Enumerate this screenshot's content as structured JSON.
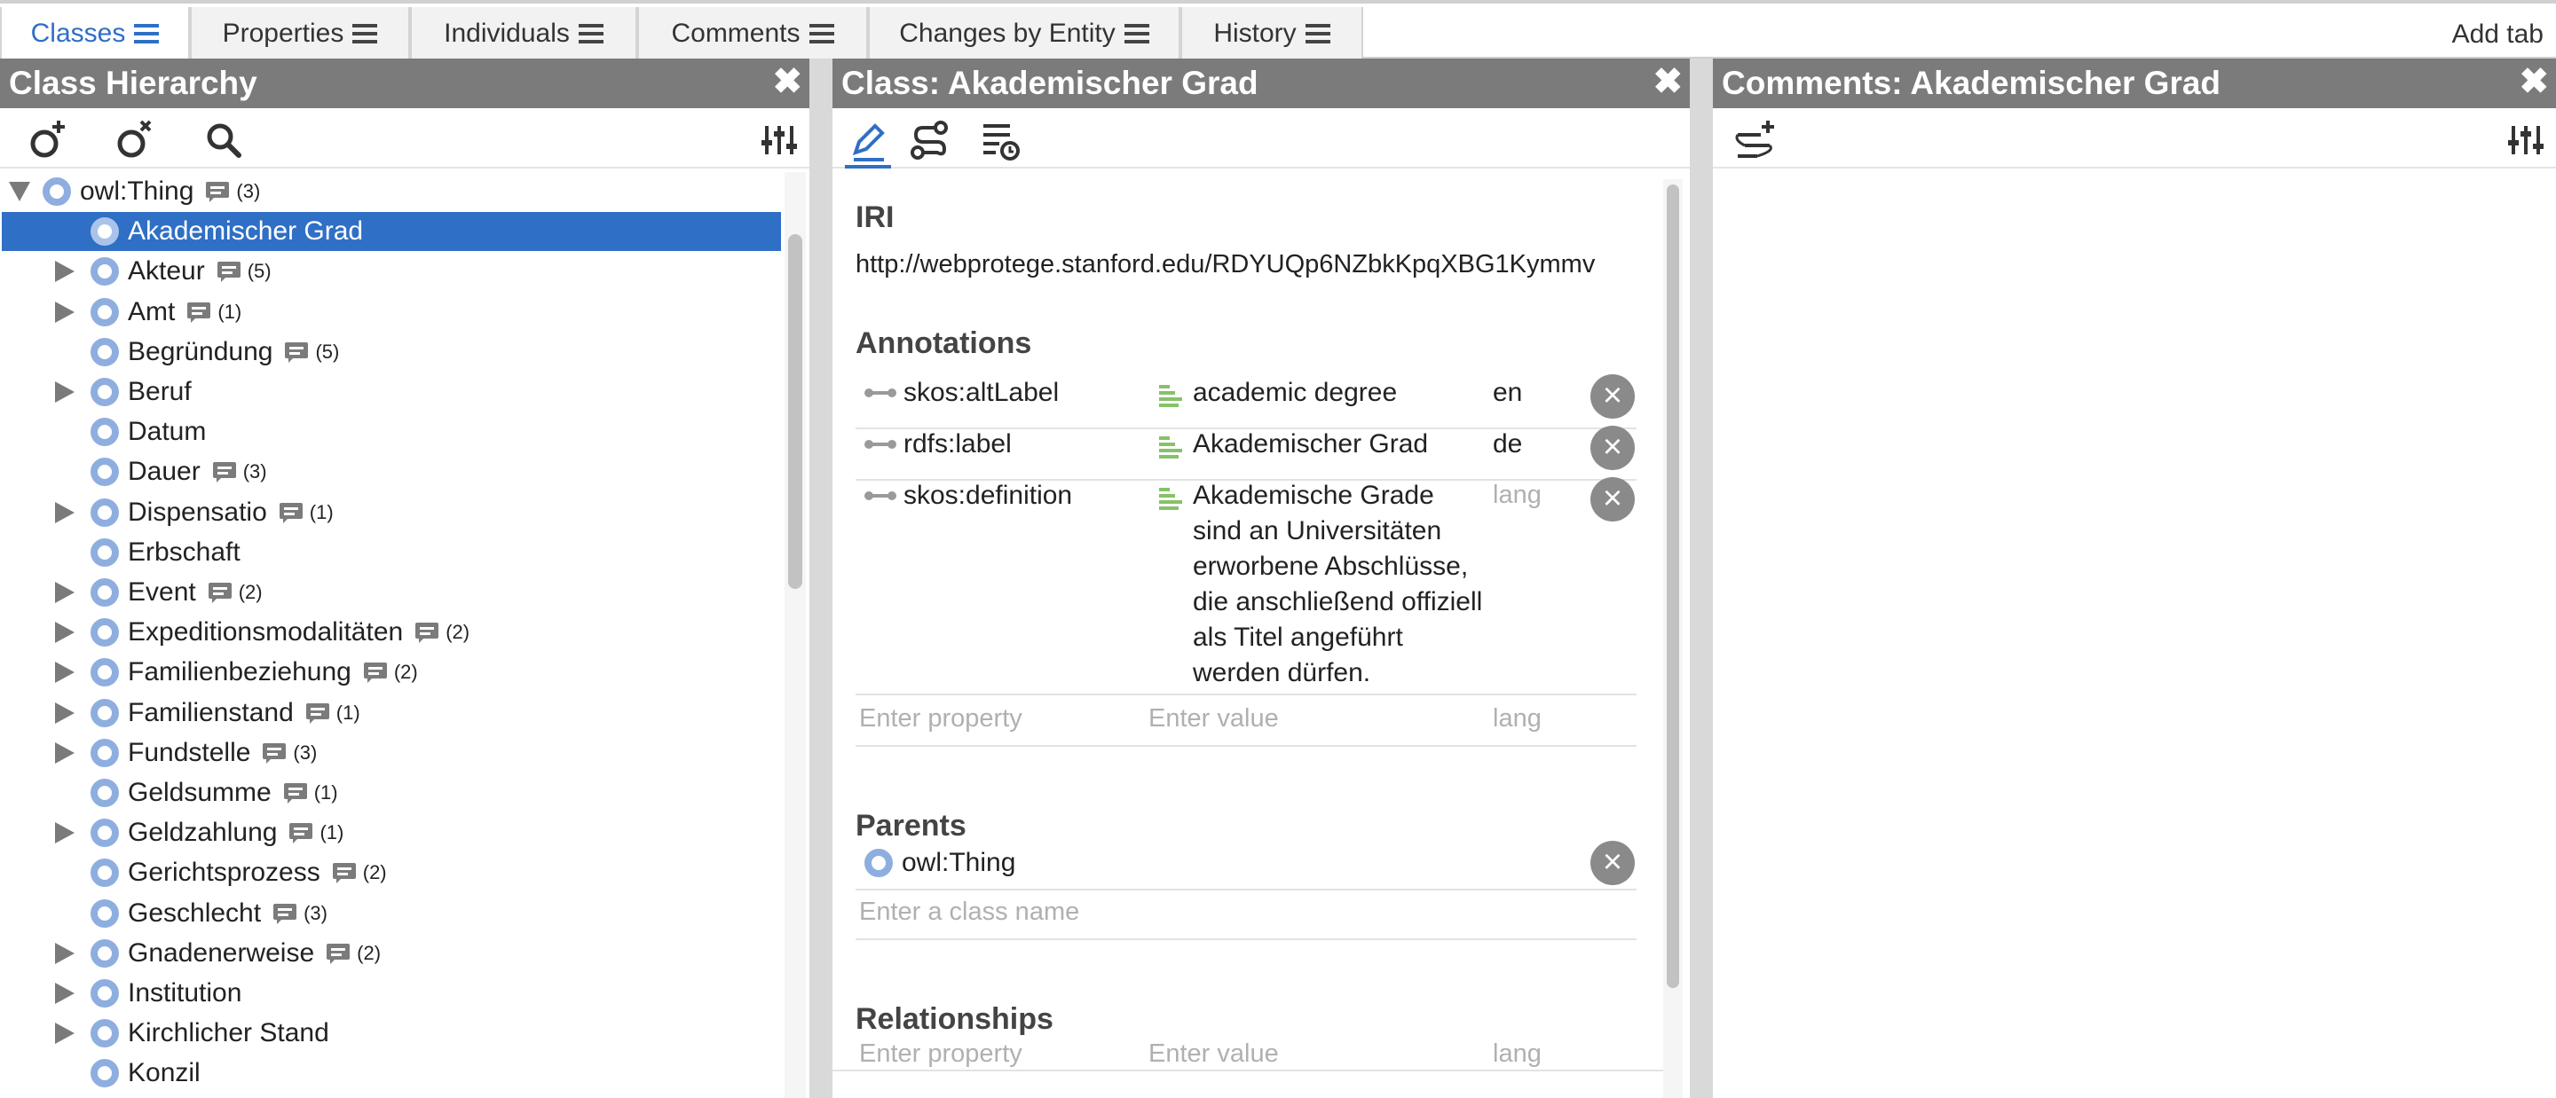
{
  "tabs": [
    {
      "label": "Classes",
      "active": true
    },
    {
      "label": "Properties",
      "active": false
    },
    {
      "label": "Individuals",
      "active": false
    },
    {
      "label": "Comments",
      "active": false
    },
    {
      "label": "Changes by Entity",
      "active": false
    },
    {
      "label": "History",
      "active": false
    }
  ],
  "add_tab": "Add tab",
  "close_glyph": "✖",
  "hierarchy": {
    "title": "Class Hierarchy",
    "root": {
      "label": "owl:Thing",
      "count": "(3)"
    },
    "items": [
      {
        "label": "Akademischer Grad",
        "count": "",
        "expandable": false,
        "selected": true
      },
      {
        "label": "Akteur",
        "count": "(5)",
        "expandable": true
      },
      {
        "label": "Amt",
        "count": "(1)",
        "expandable": true
      },
      {
        "label": "Begründung",
        "count": "(5)",
        "expandable": false
      },
      {
        "label": "Beruf",
        "count": "",
        "expandable": true
      },
      {
        "label": "Datum",
        "count": "",
        "expandable": false
      },
      {
        "label": "Dauer",
        "count": "(3)",
        "expandable": false
      },
      {
        "label": "Dispensatio",
        "count": "(1)",
        "expandable": true
      },
      {
        "label": "Erbschaft",
        "count": "",
        "expandable": false
      },
      {
        "label": "Event",
        "count": "(2)",
        "expandable": true
      },
      {
        "label": "Expeditionsmodalitäten",
        "count": "(2)",
        "expandable": true
      },
      {
        "label": "Familienbeziehung",
        "count": "(2)",
        "expandable": true
      },
      {
        "label": "Familienstand",
        "count": "(1)",
        "expandable": true
      },
      {
        "label": "Fundstelle",
        "count": "(3)",
        "expandable": true
      },
      {
        "label": "Geldsumme",
        "count": "(1)",
        "expandable": false
      },
      {
        "label": "Geldzahlung",
        "count": "(1)",
        "expandable": true
      },
      {
        "label": "Gerichtsprozess",
        "count": "(2)",
        "expandable": false
      },
      {
        "label": "Geschlecht",
        "count": "(3)",
        "expandable": false
      },
      {
        "label": "Gnadenerweise",
        "count": "(2)",
        "expandable": true
      },
      {
        "label": "Institution",
        "count": "",
        "expandable": true
      },
      {
        "label": "Kirchlicher Stand",
        "count": "",
        "expandable": true
      },
      {
        "label": "Konzil",
        "count": "",
        "expandable": false
      }
    ]
  },
  "editor": {
    "title": "Class: Akademischer Grad",
    "iri_heading": "IRI",
    "iri": "http://webprotege.stanford.edu/RDYUQp6NZbkKpqXBG1Kymmv",
    "annotations_heading": "Annotations",
    "annotations": [
      {
        "property": "skos:altLabel",
        "value_lines": [
          "academic degree"
        ],
        "lang": "en",
        "lang_placeholder": false
      },
      {
        "property": "rdfs:label",
        "value_lines": [
          "Akademischer Grad"
        ],
        "lang": "de",
        "lang_placeholder": false
      },
      {
        "property": "skos:definition",
        "value_lines": [
          "Akademische Grade",
          "sind an Universitäten",
          "erworbene Abschlüsse,",
          "die anschließend offiziell",
          "als Titel angeführt",
          "werden dürfen."
        ],
        "lang": "lang",
        "lang_placeholder": true
      }
    ],
    "placeholders": {
      "property": "Enter property",
      "value": "Enter value",
      "lang": "lang",
      "class_name": "Enter a class name"
    },
    "parents_heading": "Parents",
    "parents": [
      {
        "label": "owl:Thing"
      }
    ],
    "relationships_heading": "Relationships"
  },
  "comments": {
    "title": "Comments: Akademischer Grad"
  },
  "colors": {
    "accent": "#2f6fc5",
    "header_bg": "#7b7b7b",
    "class_icon": "#8faee0",
    "annotation_value_icon": "#86c268"
  }
}
